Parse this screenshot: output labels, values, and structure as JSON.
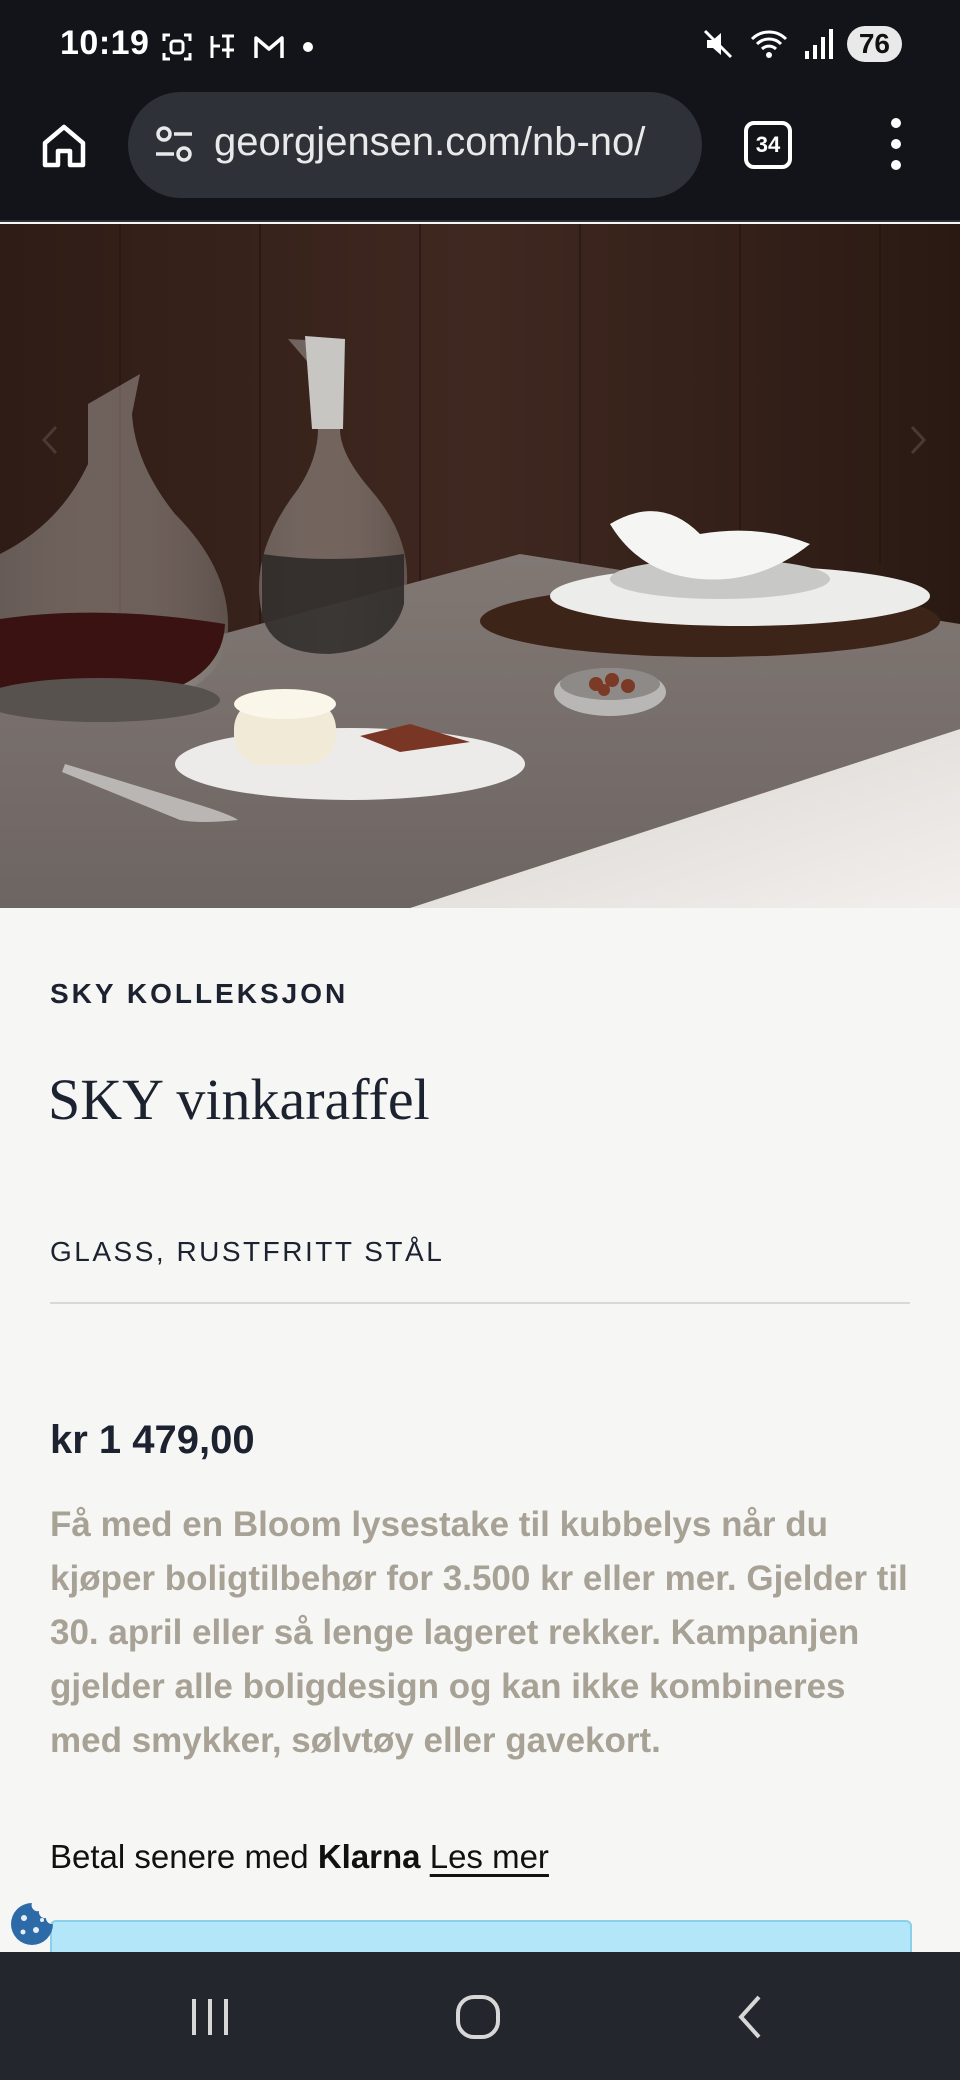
{
  "status_bar": {
    "time": "10:19",
    "battery": "76",
    "left_icons": [
      "screenshot-icon",
      "accessibility-icon",
      "gmail-icon",
      "dot-icon"
    ],
    "right_icons": [
      "mute-icon",
      "wifi-icon",
      "signal-icon"
    ]
  },
  "browser": {
    "url": "georgjensen.com/nb-no/",
    "tab_count": "34"
  },
  "product": {
    "collection": "SKY KOLLEKSJON",
    "title": "SKY vinkaraffel",
    "materials": "GLASS, RUSTFRITT STÅL",
    "price": "kr 1 479,00",
    "promo": "Få med en Bloom lysestake til kubbelys når du kjøper boligtilbehør for 3.500 kr eller mer. Gjelder til 30. april eller så lenge lageret rekker. Kampanjen gjelder alle boligdesign og kan ikke kombineres med smykker, sølvtøy eller gavekort."
  },
  "klarna": {
    "prefix": "Betal senere med",
    "brand": "Klarna",
    "link": "Les mer"
  },
  "colors": {
    "cta": "#b3e6f8",
    "promo_text": "#a7a295",
    "toolbar": "#12141a"
  }
}
